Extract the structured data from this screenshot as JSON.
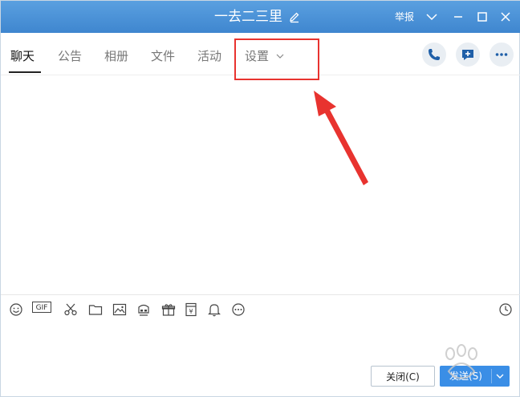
{
  "window": {
    "title": "一去二三里",
    "report_label": "举报"
  },
  "tabs": [
    {
      "label": "聊天",
      "active": true
    },
    {
      "label": "公告",
      "active": false
    },
    {
      "label": "相册",
      "active": false
    },
    {
      "label": "文件",
      "active": false
    },
    {
      "label": "活动",
      "active": false
    },
    {
      "label": "设置",
      "active": false
    }
  ],
  "header_actions": [
    "phone-icon",
    "add-chat-icon",
    "more-icon"
  ],
  "toolbar_icons": [
    "emoji-icon",
    "gif-icon",
    "scissors-icon",
    "folder-icon",
    "image-icon",
    "shake-icon",
    "gift-icon",
    "red-packet-icon",
    "bell-icon",
    "more-circle-icon",
    "history-icon"
  ],
  "toolbar": {
    "gif_label": "GIF"
  },
  "buttons": {
    "close_label": "关闭(C)",
    "send_label": "发送(S)"
  },
  "annotation": {
    "box_color": "#e8332f",
    "arrow_color": "#e8332f"
  },
  "colors": {
    "titlebar": "#4a94d9",
    "send_button": "#3a8ee6"
  }
}
